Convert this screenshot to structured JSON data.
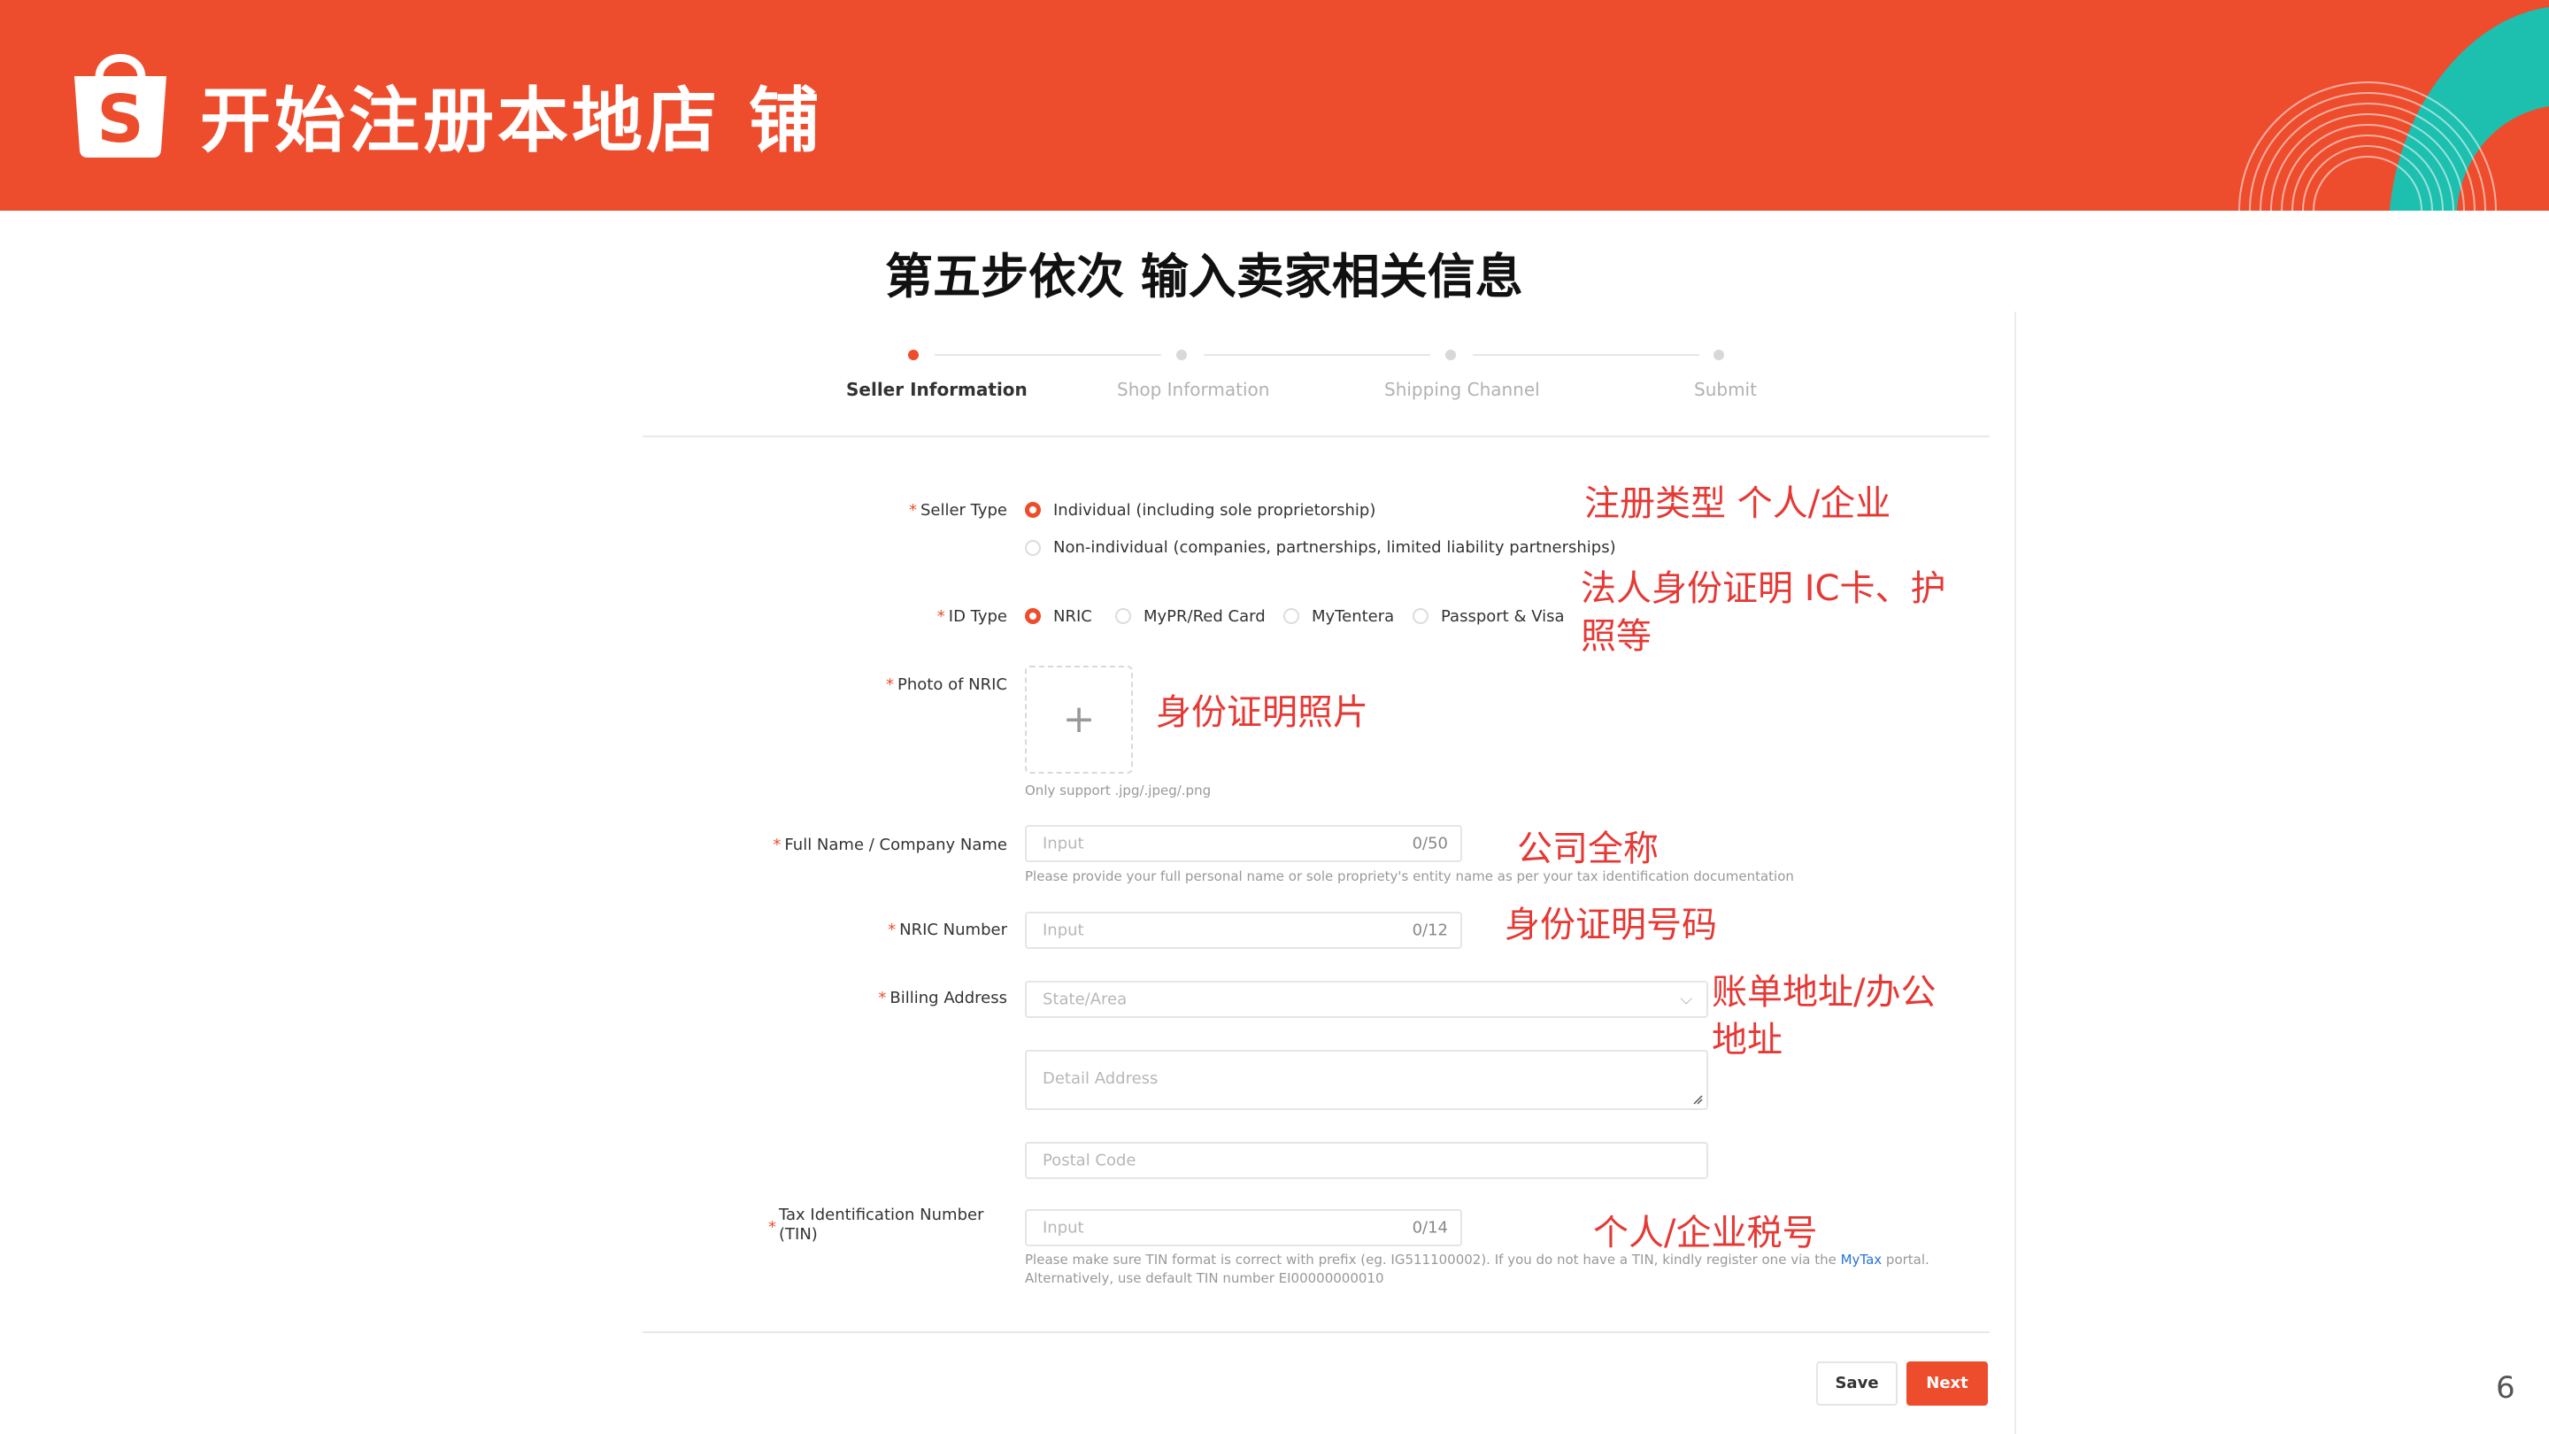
{
  "header": {
    "title": "开始注册本地店 铺",
    "logo_letter": "S",
    "brand_color": "#EE4D2D",
    "accent_color": "#1DBFAF"
  },
  "subtitle": "第五步依次 输入卖家相关信息",
  "stepper": {
    "steps": [
      {
        "label": "Seller Information",
        "active": true
      },
      {
        "label": "Shop Information",
        "active": false
      },
      {
        "label": "Shipping Channel",
        "active": false
      },
      {
        "label": "Submit",
        "active": false
      }
    ]
  },
  "form": {
    "required_mark": "*",
    "seller_type": {
      "label": "Seller Type",
      "options": [
        "Individual (including sole proprietorship)",
        "Non-individual (companies, partnerships, limited liability partnerships)"
      ],
      "selected": 0
    },
    "id_type": {
      "label": "ID Type",
      "options": [
        "NRIC",
        "MyPR/Red Card",
        "MyTentera",
        "Passport & Visa"
      ],
      "selected": 0
    },
    "photo": {
      "label": "Photo of NRIC",
      "plus": "+",
      "hint": "Only support .jpg/.jpeg/.png"
    },
    "full_name": {
      "label": "Full Name / Company Name",
      "placeholder": "Input",
      "counter": "0/50",
      "hint": "Please provide your full personal name or sole propriety's entity name as per your tax identification documentation"
    },
    "nric_number": {
      "label": "NRIC Number",
      "placeholder": "Input",
      "counter": "0/12"
    },
    "billing_address": {
      "label": "Billing Address",
      "state_placeholder": "State/Area",
      "chevron": "⌵",
      "detail_placeholder": "Detail Address",
      "postal_placeholder": "Postal Code"
    },
    "tin": {
      "label_line1": "Tax Identification Number",
      "label_line2": "(TIN)",
      "placeholder": "Input",
      "counter": "0/14",
      "hint_line1_a": "Please make sure TIN format is correct with prefix (eg. IG511100002). If you do not have a TIN, kindly register one via the ",
      "hint_link": "MyTax",
      "hint_line1_b": " portal.",
      "hint_line2": "Alternatively, use default TIN number EI00000000010"
    }
  },
  "annotations": {
    "seller_type": "注册类型 个人/企业",
    "id_type_line1": "法人身份证明 IC卡、护",
    "id_type_line2": "照等",
    "photo": "身份证明照片",
    "full_name": "公司全称",
    "nric_number": "身份证明号码",
    "billing_line1": "账单地址/办公",
    "billing_line2": "地址",
    "tin": "个人/企业税号"
  },
  "footer": {
    "save_label": "Save",
    "next_label": "Next",
    "page_number": "6"
  }
}
